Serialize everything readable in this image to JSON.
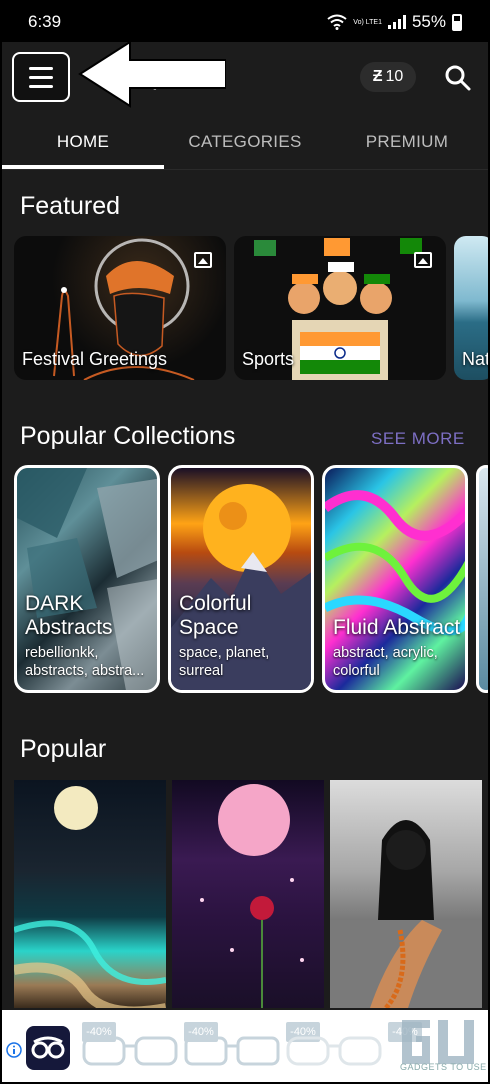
{
  "status_bar": {
    "time": "6:39",
    "battery": "55%",
    "network": "Vo) LTE1"
  },
  "app_bar": {
    "title": "pers",
    "coins": "10"
  },
  "tabs": [
    {
      "label": "HOME"
    },
    {
      "label": "CATEGORIES"
    },
    {
      "label": "PREMIUM"
    }
  ],
  "featured": {
    "title": "Featured",
    "items": [
      {
        "label": "Festival Greetings"
      },
      {
        "label": "Sports"
      },
      {
        "label": "Nat"
      }
    ]
  },
  "collections": {
    "title": "Popular Collections",
    "see_more": "SEE MORE",
    "items": [
      {
        "title_line1": "DARK",
        "title_line2": "Abstracts",
        "tags_line1": "rebellionkk,",
        "tags_line2": "abstracts, abstra..."
      },
      {
        "title_line1": "Colorful",
        "title_line2": "Space",
        "tags_line1": "space, planet,",
        "tags_line2": "surreal"
      },
      {
        "title_line1": "",
        "title_line2": "Fluid Abstract",
        "tags_line1": "abstract, acrylic,",
        "tags_line2": "colorful"
      }
    ]
  },
  "popular": {
    "title": "Popular"
  },
  "ad": {
    "badges": [
      "-40%",
      "-40%",
      "-40%",
      "-40%"
    ],
    "watermark": "GADGETS TO USE"
  },
  "colors": {
    "background": "#1c1c1c",
    "accent": "#7d6fc4",
    "status_bar": "#000000"
  },
  "icons": [
    "menu-icon",
    "arrow-annotation",
    "coin-icon",
    "search-icon",
    "image-icon",
    "ad-info-icon"
  ]
}
